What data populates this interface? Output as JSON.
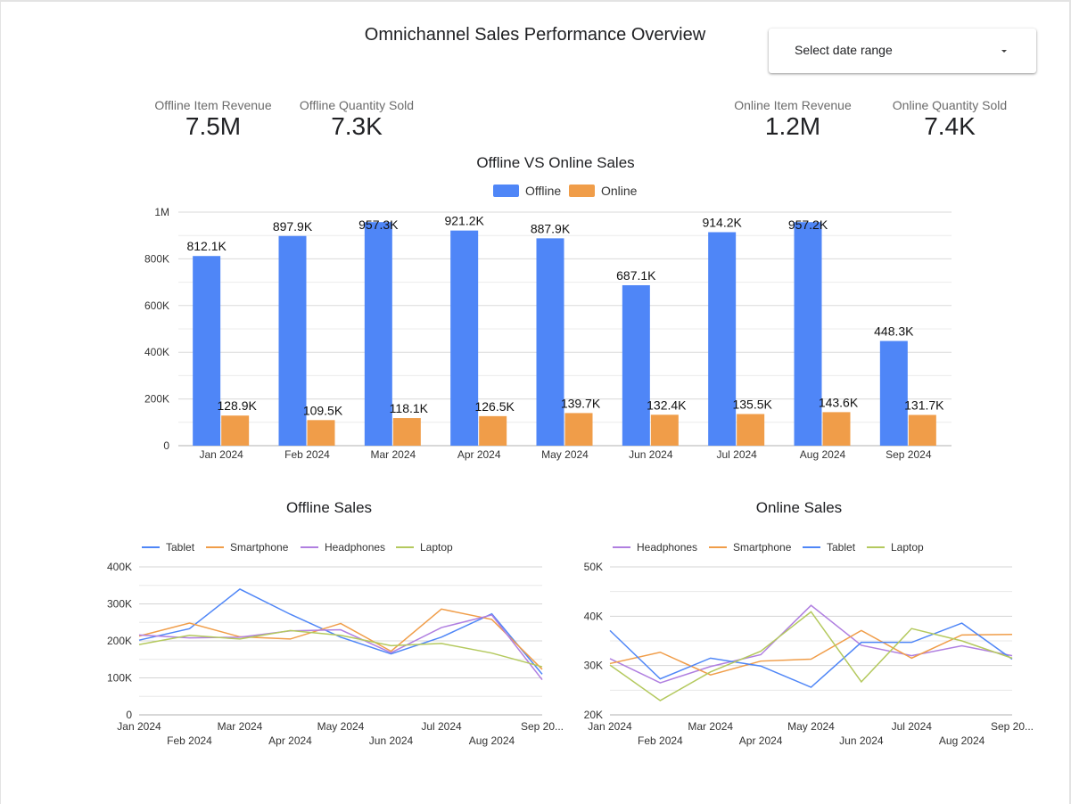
{
  "page": {
    "title": "Omnichannel Sales Performance Overview",
    "date_range_label": "Select date range"
  },
  "kpis": [
    {
      "label": "Offline Item Revenue",
      "value": "7.5M"
    },
    {
      "label": "Offline Quantity Sold",
      "value": "7.3K"
    },
    {
      "label": "Online Item Revenue",
      "value": "1.2M"
    },
    {
      "label": "Online Quantity Sold",
      "value": "7.4K"
    }
  ],
  "colors": {
    "offline": "#4f86f7",
    "online": "#f09d49",
    "tablet": "#4f86f7",
    "smartphone": "#f09d49",
    "headphones": "#b07fe0",
    "laptop": "#b4c95e"
  },
  "chart_data": [
    {
      "type": "bar",
      "title": "Offline VS Online Sales",
      "categories": [
        "Jan 2024",
        "Feb 2024",
        "Mar 2024",
        "Apr 2024",
        "May 2024",
        "Jun 2024",
        "Jul 2024",
        "Aug 2024",
        "Sep 2024"
      ],
      "series": [
        {
          "name": "Offline",
          "values": [
            812100,
            897900,
            957300,
            921200,
            887900,
            687100,
            914200,
            957200,
            448300
          ],
          "labels": [
            "812.1K",
            "897.9K",
            "957.3K",
            "921.2K",
            "887.9K",
            "687.1K",
            "914.2K",
            "957.2K",
            "448.3K"
          ]
        },
        {
          "name": "Online",
          "values": [
            128900,
            109500,
            118100,
            126500,
            139700,
            132400,
            135500,
            143600,
            131700
          ],
          "labels": [
            "128.9K",
            "109.5K",
            "118.1K",
            "126.5K",
            "139.7K",
            "132.4K",
            "135.5K",
            "143.6K",
            "131.7K"
          ]
        }
      ],
      "ylim": [
        0,
        1000000
      ],
      "yticks": [
        0,
        200000,
        400000,
        600000,
        800000,
        1000000
      ],
      "ytick_labels": [
        "0",
        "200K",
        "400K",
        "600K",
        "800K",
        "1M"
      ],
      "legend": "top",
      "grid": true
    },
    {
      "type": "line",
      "title": "Offline Sales",
      "x_labels": [
        "Jan 2024",
        "Feb 2024",
        "Mar 2024",
        "Apr 2024",
        "May 2024",
        "Jun 2024",
        "Jul 2024",
        "Aug 2024",
        "Sep 20..."
      ],
      "series": [
        {
          "name": "Tablet",
          "color_key": "tablet",
          "values": [
            202000,
            233000,
            340000,
            272000,
            210000,
            165000,
            210000,
            273000,
            110000
          ]
        },
        {
          "name": "Smartphone",
          "color_key": "smartphone",
          "values": [
            213000,
            248000,
            211000,
            205000,
            247000,
            172000,
            286000,
            258000,
            123000
          ]
        },
        {
          "name": "Headphones",
          "color_key": "headphones",
          "values": [
            216000,
            208000,
            210000,
            227000,
            230000,
            168000,
            236000,
            270000,
            95000
          ]
        },
        {
          "name": "Laptop",
          "color_key": "laptop",
          "values": [
            190000,
            215000,
            205000,
            228000,
            215000,
            187000,
            193000,
            167000,
            130000
          ]
        }
      ],
      "ylim": [
        0,
        400000
      ],
      "yticks": [
        0,
        100000,
        200000,
        300000,
        400000
      ],
      "ytick_labels": [
        "0",
        "100K",
        "200K",
        "300K",
        "400K"
      ],
      "legend": "top",
      "grid": true
    },
    {
      "type": "line",
      "title": "Online Sales",
      "x_labels": [
        "Jan 2024",
        "Feb 2024",
        "Mar 2024",
        "Apr 2024",
        "May 2024",
        "Jun 2024",
        "Jul 2024",
        "Aug 2024",
        "Sep 20..."
      ],
      "series": [
        {
          "name": "Headphones",
          "color_key": "headphones",
          "values": [
            31400,
            26500,
            29800,
            32200,
            42200,
            34100,
            32000,
            34000,
            32000
          ]
        },
        {
          "name": "Smartphone",
          "color_key": "smartphone",
          "values": [
            30400,
            32700,
            28100,
            30900,
            31300,
            37100,
            31500,
            36200,
            36300
          ]
        },
        {
          "name": "Tablet",
          "color_key": "tablet",
          "values": [
            37100,
            27300,
            31500,
            29900,
            25600,
            34700,
            34700,
            38600,
            31300
          ]
        },
        {
          "name": "Laptop",
          "color_key": "laptop",
          "values": [
            30100,
            22900,
            28700,
            32900,
            40900,
            26700,
            37500,
            35000,
            31500
          ]
        }
      ],
      "ylim": [
        20000,
        50000
      ],
      "yticks": [
        20000,
        30000,
        40000,
        50000
      ],
      "ytick_labels": [
        "20K",
        "30K",
        "40K",
        "50K"
      ],
      "legend": "top",
      "grid": true
    }
  ]
}
